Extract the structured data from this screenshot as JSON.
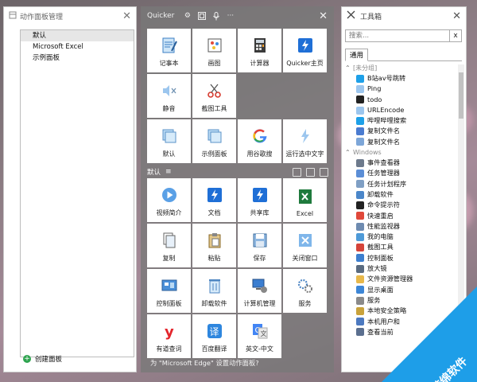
{
  "left_panel": {
    "title": "动作面板管理",
    "items": [
      "默认",
      "Microsoft Excel",
      "示例面板"
    ],
    "add_label": "创建面板"
  },
  "quicker": {
    "title": "Quicker",
    "top_grid": [
      {
        "label": "记事本",
        "icon": "notepad-icon"
      },
      {
        "label": "画图",
        "icon": "paint-icon"
      },
      {
        "label": "计算器",
        "icon": "calculator-icon"
      },
      {
        "label": "Quicker主页",
        "icon": "quicker-lightning-icon"
      },
      {
        "label": "静音",
        "icon": "mute-icon"
      },
      {
        "label": "截图工具",
        "icon": "scissors-icon"
      },
      {
        "label": "",
        "icon": ""
      },
      {
        "label": "",
        "icon": ""
      },
      {
        "label": "默认",
        "icon": "panel-icon"
      },
      {
        "label": "示例面板",
        "icon": "panel-icon"
      },
      {
        "label": "用谷歌搜",
        "icon": "google-icon"
      },
      {
        "label": "运行选中文字",
        "icon": "lightning-icon"
      }
    ],
    "section_title": "默认",
    "bottom_grid": [
      {
        "label": "视频简介",
        "icon": "play-icon"
      },
      {
        "label": "文档",
        "icon": "quicker-lightning-icon"
      },
      {
        "label": "共享库",
        "icon": "quicker-lightning-icon"
      },
      {
        "label": "Excel",
        "icon": "excel-icon"
      },
      {
        "label": "复制",
        "icon": "copy-icon"
      },
      {
        "label": "粘贴",
        "icon": "paste-icon"
      },
      {
        "label": "保存",
        "icon": "save-icon"
      },
      {
        "label": "关闭窗口",
        "icon": "close-window-icon"
      },
      {
        "label": "控制面板",
        "icon": "control-panel-icon"
      },
      {
        "label": "卸载软件",
        "icon": "recycle-icon"
      },
      {
        "label": "计算机管理",
        "icon": "computer-manage-icon"
      },
      {
        "label": "服务",
        "icon": "gears-icon"
      },
      {
        "label": "有道查词",
        "icon": "youdao-icon"
      },
      {
        "label": "百度翻译",
        "icon": "baidu-translate-icon"
      },
      {
        "label": "英文-中文",
        "icon": "google-translate-icon"
      },
      {
        "label": "",
        "icon": ""
      }
    ],
    "footer_text": "为 \"Microsoft Edge\" 设置动作面板?"
  },
  "toolbox": {
    "title": "工具箱",
    "search_placeholder": "搜索...",
    "clear_label": "x",
    "tab_label": "通用",
    "groups": [
      {
        "name": "[未分组]",
        "items": [
          {
            "label": "B站av号跳转",
            "color": "#1ea0e8"
          },
          {
            "label": "Ping",
            "color": "#9cc6ee"
          },
          {
            "label": "todo",
            "color": "#222222"
          },
          {
            "label": "URLEncode",
            "color": "#9cc6ee"
          },
          {
            "label": "哔哩哔哩搜索",
            "color": "#1ea0e8"
          },
          {
            "label": "复制文件名",
            "color": "#4a7bd0"
          },
          {
            "label": "复制文件名",
            "color": "#7da6d8"
          }
        ]
      },
      {
        "name": "Windows",
        "items": [
          {
            "label": "事件查看器",
            "color": "#6d7a8c"
          },
          {
            "label": "任务管理器",
            "color": "#5b8ed6"
          },
          {
            "label": "任务计划程序",
            "color": "#7f9fc4"
          },
          {
            "label": "卸载软件",
            "color": "#4b86c9"
          },
          {
            "label": "命令提示符",
            "color": "#222222"
          },
          {
            "label": "快速重启",
            "color": "#e0483a"
          },
          {
            "label": "性能监视器",
            "color": "#6e8bb0"
          },
          {
            "label": "我的电脑",
            "color": "#4e9ad8"
          },
          {
            "label": "截图工具",
            "color": "#d5443a"
          },
          {
            "label": "控制面板",
            "color": "#3d7fcf"
          },
          {
            "label": "放大镜",
            "color": "#5a6b80"
          },
          {
            "label": "文件资源管理器",
            "color": "#e8b84a"
          },
          {
            "label": "显示桌面",
            "color": "#3d86d6"
          },
          {
            "label": "服务",
            "color": "#8a8a8a"
          },
          {
            "label": "本地安全策略",
            "color": "#c9a23b"
          },
          {
            "label": "本机用户和",
            "color": "#4c79c0"
          },
          {
            "label": "查看当前",
            "color": "#5b6f8f"
          }
        ]
      }
    ]
  },
  "watermark": {
    "text": "游绵软件"
  }
}
